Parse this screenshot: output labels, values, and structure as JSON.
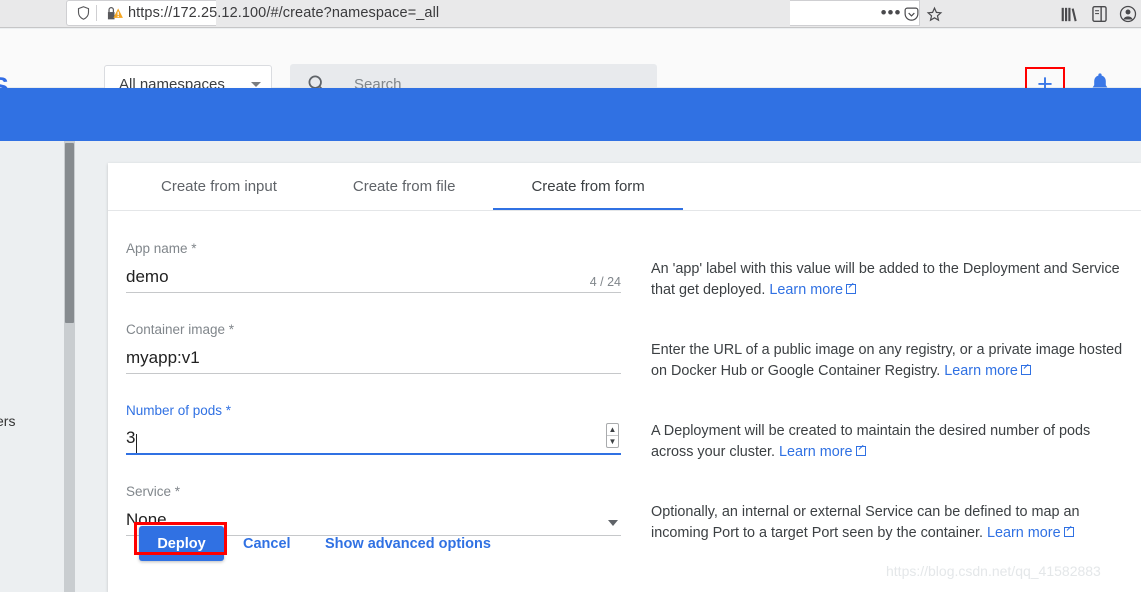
{
  "browser": {
    "url": "https://172.25.12.100/#/create?namespace=_all",
    "icons": {
      "shield": "shield-icon",
      "lock_warning": "lock-warning-icon",
      "page_actions": "…",
      "pocket": "pocket-icon",
      "bookmark_star": "star-icon",
      "library": "library-icon",
      "sidebar": "sidebar-icon",
      "account": "account-icon"
    }
  },
  "app_bar": {
    "brand": "S",
    "namespace_selector": {
      "label": "All namespaces",
      "icon": "chevron-down-icon"
    },
    "search": {
      "placeholder": "Search",
      "value": "",
      "icon": "search-icon"
    },
    "add_button": {
      "label": "+",
      "highlighted": true,
      "highlight_color": "#ff0000"
    },
    "notifications": {
      "icon": "bell-icon"
    }
  },
  "theme": {
    "banner_color": "#3071e3",
    "accent_color": "#3071e3",
    "page_background": "#eceff1",
    "highlight_color": "#ff0000"
  },
  "side_nav": {
    "truncated_item": "ers",
    "scrollbar": "vertical-scrollbar"
  },
  "card": {
    "tabs": [
      {
        "label": "Create from input",
        "active": false
      },
      {
        "label": "Create from file",
        "active": false
      },
      {
        "label": "Create from form",
        "active": true
      }
    ],
    "fields": [
      {
        "label": "App name *",
        "value": "demo",
        "counter": "4 / 24",
        "focused": false,
        "help": {
          "text": "An 'app' label with this value will be added to the Deployment and Service that get deployed.",
          "link": "Learn more"
        }
      },
      {
        "label": "Container image *",
        "value": "myapp:v1",
        "counter": "",
        "focused": false,
        "help": {
          "text": "Enter the URL of a public image on any registry, or a private image hosted on Docker Hub or Google Container Registry.",
          "link": "Learn more"
        }
      },
      {
        "label": "Number of pods *",
        "value": "3",
        "counter": "",
        "focused": true,
        "help": {
          "text": "A Deployment will be created to maintain the desired number of pods across your cluster.",
          "link": "Learn more"
        }
      },
      {
        "label": "Service *",
        "value": "None",
        "counter": "",
        "focused": false,
        "help": {
          "text": "Optionally, an internal or external Service can be defined to map an incoming Port to a target Port seen by the container.",
          "link": "Learn more"
        }
      }
    ],
    "actions": {
      "deploy": "Deploy",
      "cancel": "Cancel",
      "advanced": "Show advanced options",
      "deploy_highlighted": true
    }
  },
  "watermark": "https://blog.csdn.net/qq_41582883"
}
